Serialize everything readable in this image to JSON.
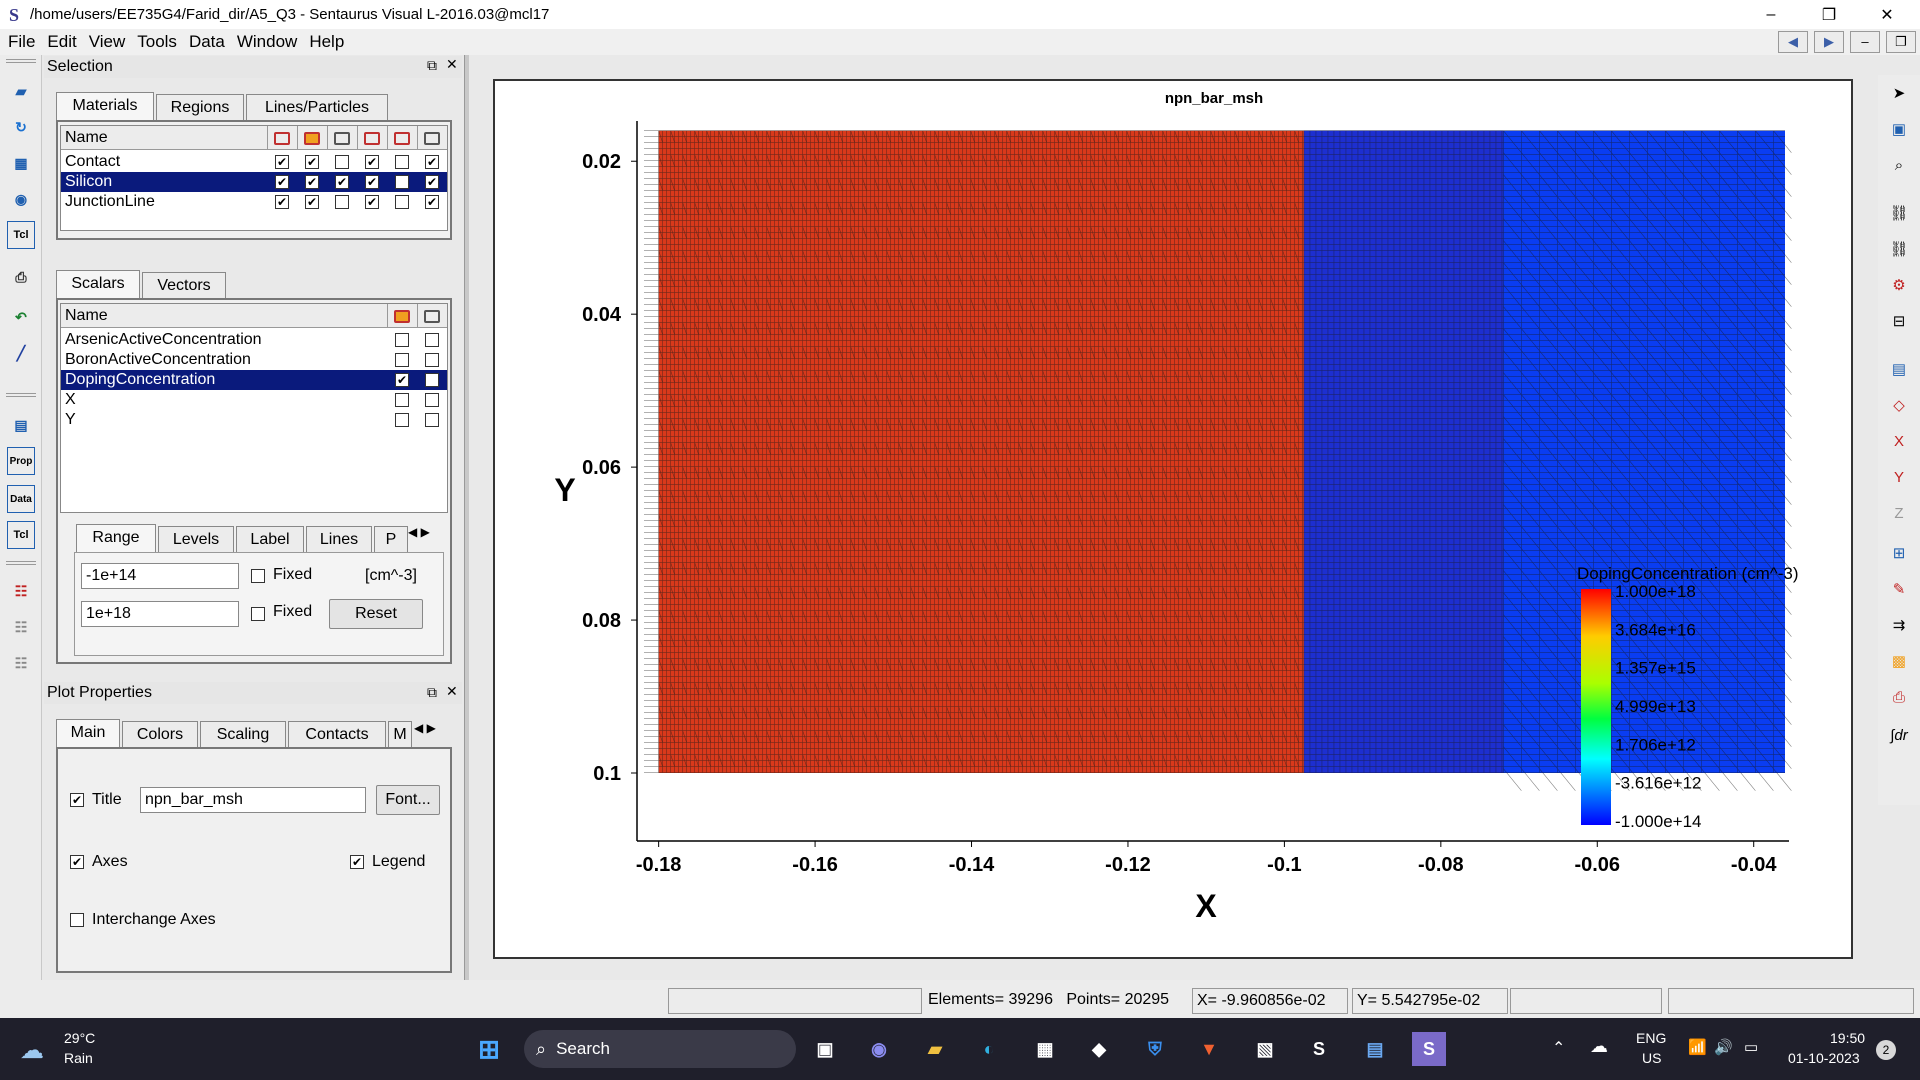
{
  "window": {
    "title": "/home/users/EE735G4/Farid_dir/A5_Q3 - Sentaurus Visual L-2016.03@mcl17",
    "app_icon": "S",
    "minimize": "–",
    "maximize": "❐",
    "close": "✕"
  },
  "menu": [
    "File",
    "Edit",
    "View",
    "Tools",
    "Data",
    "Window",
    "Help"
  ],
  "selection_panel": {
    "title": "Selection",
    "tabs": [
      "Materials",
      "Regions",
      "Lines/Particles"
    ],
    "name_header": "Name",
    "materials": [
      {
        "name": "Contact",
        "checks": [
          true,
          true,
          false,
          true,
          false,
          true
        ],
        "selected": false
      },
      {
        "name": "Silicon",
        "checks": [
          true,
          true,
          true,
          true,
          false,
          true
        ],
        "selected": true
      },
      {
        "name": "JunctionLine",
        "checks": [
          true,
          true,
          false,
          true,
          false,
          true
        ],
        "selected": false
      }
    ],
    "scalar_tabs": [
      "Scalars",
      "Vectors"
    ],
    "scalars": [
      {
        "name": "ArsenicActiveConcentration",
        "checks": [
          false,
          false
        ],
        "selected": false
      },
      {
        "name": "BoronActiveConcentration",
        "checks": [
          false,
          false
        ],
        "selected": false
      },
      {
        "name": "DopingConcentration",
        "checks": [
          true,
          false
        ],
        "selected": true
      },
      {
        "name": "X",
        "checks": [
          false,
          false
        ],
        "selected": false
      },
      {
        "name": "Y",
        "checks": [
          false,
          false
        ],
        "selected": false
      }
    ],
    "range_tabs": [
      "Range",
      "Levels",
      "Label",
      "Lines",
      "P"
    ],
    "range_min": "-1e+14",
    "range_max": "1e+18",
    "fixed_label": "Fixed",
    "unit": "[cm^-3]",
    "reset_label": "Reset"
  },
  "plot_properties": {
    "title": "Plot Properties",
    "tabs": [
      "Main",
      "Colors",
      "Scaling",
      "Contacts",
      "M"
    ],
    "title_label": "Title",
    "title_checked": true,
    "title_value": "npn_bar_msh",
    "font_button": "Font...",
    "axes_label": "Axes",
    "axes_checked": true,
    "legend_label": "Legend",
    "legend_checked": true,
    "interchange_label": "Interchange Axes",
    "interchange_checked": false
  },
  "plot": {
    "title": "npn_bar_msh",
    "xlabel": "X",
    "ylabel": "Y",
    "xticks": [
      "-0.18",
      "-0.16",
      "-0.14",
      "-0.12",
      "-0.1",
      "-0.08",
      "-0.06",
      "-0.04"
    ],
    "yticks": [
      "0.02",
      "0.04",
      "0.06",
      "0.08",
      "0.1"
    ],
    "legend_title": "DopingConcentration (cm^-3)",
    "legend_labels": [
      "1.000e+18",
      "3.684e+16",
      "1.357e+15",
      "4.999e+13",
      "1.706e+12",
      "-3.616e+12",
      "-1.000e+14"
    ],
    "colors": {
      "p_region": "#d9391b",
      "n_region_dense": "#1d2fd0",
      "n_region": "#0a3df2",
      "mesh": "#1a1a1a"
    }
  },
  "chart_data": {
    "type": "heatmap",
    "title": "npn_bar_msh",
    "xlabel": "X",
    "ylabel": "Y",
    "xlim": [
      -0.182,
      -0.036
    ],
    "ylim": [
      0.1,
      0.015
    ],
    "x_ticks": [
      -0.18,
      -0.16,
      -0.14,
      -0.12,
      -0.1,
      -0.08,
      -0.06,
      -0.04
    ],
    "y_ticks": [
      0.02,
      0.04,
      0.06,
      0.08,
      0.1
    ],
    "regions": [
      {
        "x_range": [
          -0.18,
          -0.0975
        ],
        "y_range": [
          0.016,
          0.1
        ],
        "value": "1.000e+18"
      },
      {
        "x_range": [
          -0.0975,
          -0.036
        ],
        "y_range": [
          0.016,
          0.1
        ],
        "value": "-1.000e+14"
      }
    ],
    "legend": {
      "title": "DopingConcentration (cm^-3)",
      "placement": "bottom-right",
      "labels": [
        "1.000e+18",
        "3.684e+16",
        "1.357e+15",
        "4.999e+13",
        "1.706e+12",
        "-3.616e+12",
        "-1.000e+14"
      ]
    }
  },
  "status": {
    "elements": "Elements= 39296",
    "points": "Points= 20295",
    "x": "X= -9.960856e-02",
    "y": "Y= 5.542795e-02"
  },
  "taskbar": {
    "temp": "29°C",
    "weather": "Rain",
    "search": "Search",
    "lang1": "ENG",
    "lang2": "US",
    "time": "19:50",
    "date": "01-10-2023",
    "badge": "2"
  }
}
